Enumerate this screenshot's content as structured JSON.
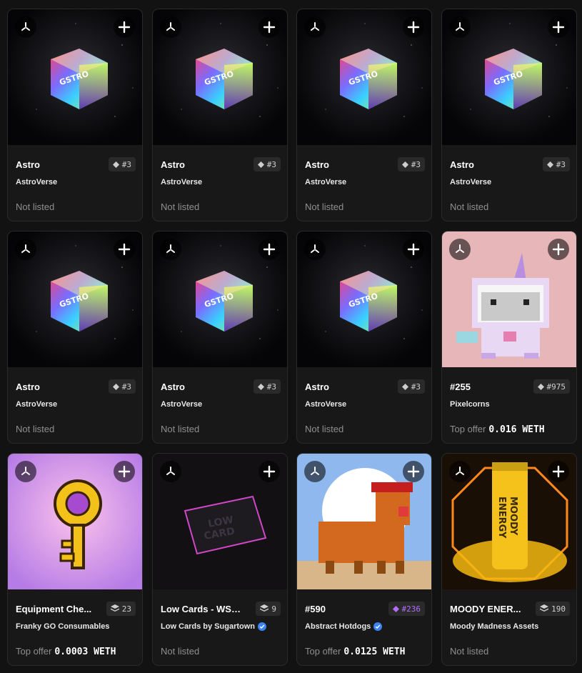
{
  "cards": [
    {
      "name": "Astro",
      "collection": "AstroVerse",
      "verified": false,
      "tag": "#3",
      "tag_icon": "diamond-icon",
      "tag_color": "gray",
      "status": "Not listed",
      "price": "",
      "image": "astro-box"
    },
    {
      "name": "Astro",
      "collection": "AstroVerse",
      "verified": false,
      "tag": "#3",
      "tag_icon": "diamond-icon",
      "tag_color": "gray",
      "status": "Not listed",
      "price": "",
      "image": "astro-box"
    },
    {
      "name": "Astro",
      "collection": "AstroVerse",
      "verified": false,
      "tag": "#3",
      "tag_icon": "diamond-icon",
      "tag_color": "gray",
      "status": "Not listed",
      "price": "",
      "image": "astro-box"
    },
    {
      "name": "Astro",
      "collection": "AstroVerse",
      "verified": false,
      "tag": "#3",
      "tag_icon": "diamond-icon",
      "tag_color": "gray",
      "status": "Not listed",
      "price": "",
      "image": "astro-box"
    },
    {
      "name": "Astro",
      "collection": "AstroVerse",
      "verified": false,
      "tag": "#3",
      "tag_icon": "diamond-icon",
      "tag_color": "gray",
      "status": "Not listed",
      "price": "",
      "image": "astro-box"
    },
    {
      "name": "Astro",
      "collection": "AstroVerse",
      "verified": false,
      "tag": "#3",
      "tag_icon": "diamond-icon",
      "tag_color": "gray",
      "status": "Not listed",
      "price": "",
      "image": "astro-box"
    },
    {
      "name": "Astro",
      "collection": "AstroVerse",
      "verified": false,
      "tag": "#3",
      "tag_icon": "diamond-icon",
      "tag_color": "gray",
      "status": "Not listed",
      "price": "",
      "image": "astro-box"
    },
    {
      "name": "#255",
      "collection": "Pixelcorns",
      "verified": false,
      "tag": "#975",
      "tag_icon": "diamond-icon",
      "tag_color": "gray",
      "status": "Top offer",
      "price": "0.016 WETH",
      "image": "pixelcorn"
    },
    {
      "name": "Equipment Che...",
      "collection": "Franky GO Consumables",
      "verified": false,
      "tag": "23",
      "tag_icon": "layers-icon",
      "tag_color": "gray",
      "status": "Top offer",
      "price": "0.0003 WETH",
      "image": "key"
    },
    {
      "name": "Low Cards - WSOA",
      "collection": "Low Cards by Sugartown",
      "verified": true,
      "tag": "9",
      "tag_icon": "layers-icon",
      "tag_color": "gray",
      "status": "Not listed",
      "price": "",
      "image": "low-card"
    },
    {
      "name": "#590",
      "collection": "Abstract Hotdogs",
      "verified": true,
      "tag": "#236",
      "tag_icon": "diamond-icon",
      "tag_color": "purple",
      "status": "Top offer",
      "price": "0.0125 WETH",
      "image": "hotdog"
    },
    {
      "name": "MOODY ENER...",
      "collection": "Moody Madness Assets",
      "verified": false,
      "tag": "190",
      "tag_icon": "layers-icon",
      "tag_color": "gray",
      "status": "Not listed",
      "price": "",
      "image": "energy-can"
    }
  ],
  "colors": {
    "accent_purple": "#b56cff",
    "verified_blue": "#3b82f6",
    "card_bg": "#181818"
  }
}
